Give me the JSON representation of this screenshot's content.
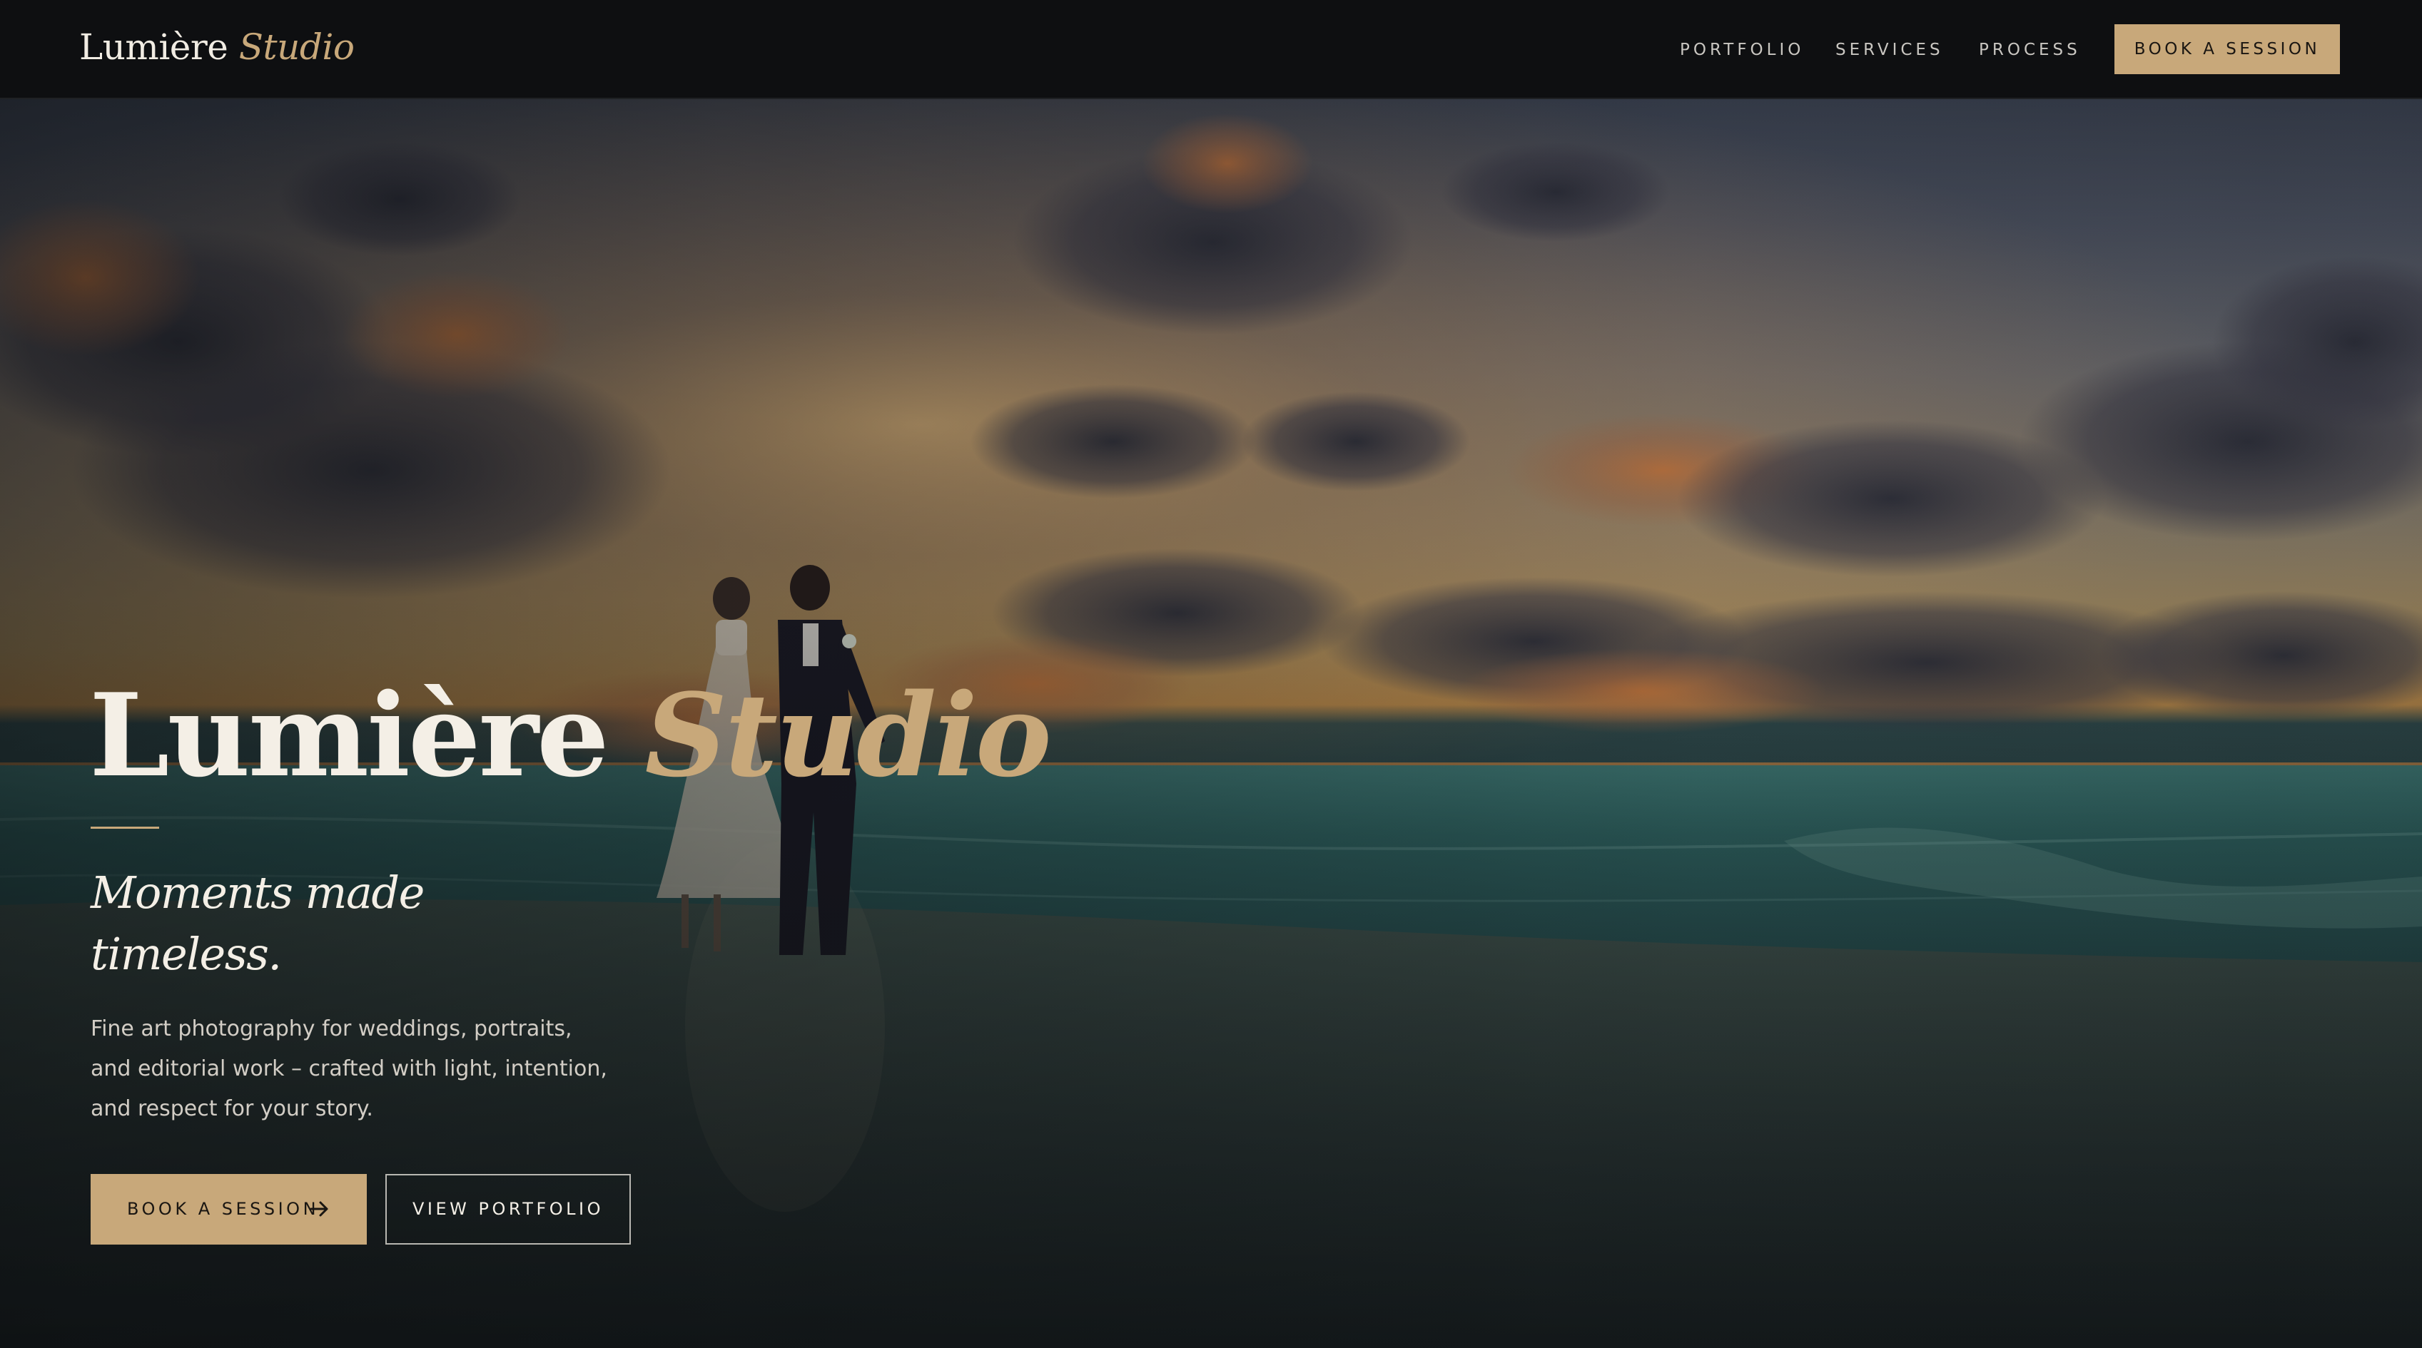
{
  "nav": {
    "brand_main": "Lumière",
    "brand_accent": "Studio",
    "links": [
      {
        "label": "PORTFOLIO"
      },
      {
        "label": "SERVICES"
      },
      {
        "label": "PROCESS"
      }
    ],
    "cta_label": "BOOK A SESSION"
  },
  "hero": {
    "title_main": "Lumière",
    "title_accent": "Studio",
    "tagline_line1": "Moments made",
    "tagline_line2": "timeless.",
    "description": "Fine art photography for weddings, portraits, and editorial work – crafted with light, intention, and respect for your story.",
    "primary_button": "BOOK A SESSION",
    "secondary_button": "VIEW PORTFOLIO",
    "image_subject": "couple-walking-on-beach-at-sunset"
  },
  "colors": {
    "background": "#0e0f11",
    "accent_gold": "#c8a87a",
    "text_light": "#f4efe6",
    "text_muted": "#c9c6c1"
  },
  "icons": {
    "button_arrow": "arrow-right-icon"
  }
}
